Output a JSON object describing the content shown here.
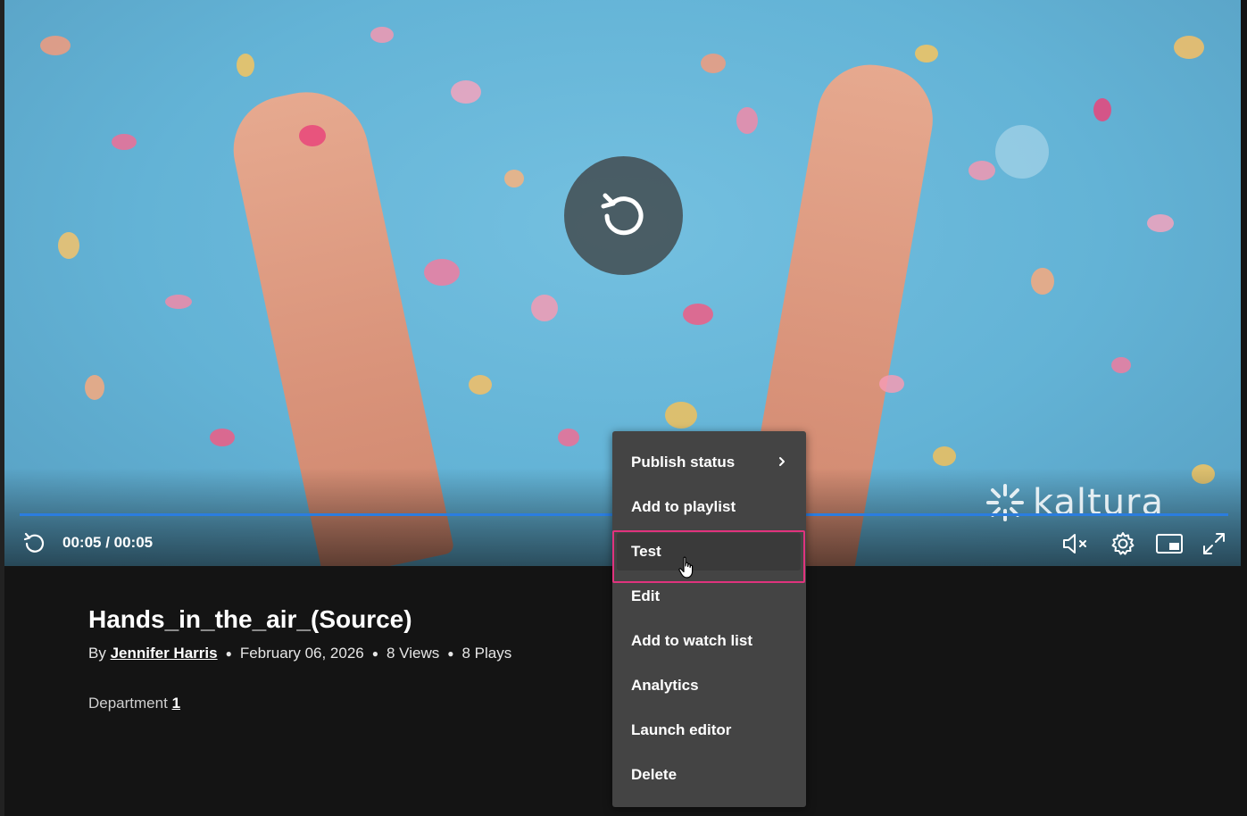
{
  "player": {
    "time_display": "00:05 / 00:05",
    "watermark": "kaltura",
    "progress_fraction": 1.0,
    "accent_color": "#2b7de0",
    "replay_icon": "replay-icon"
  },
  "entry": {
    "title": "Hands_in_the_air_(Source)",
    "by_label": "By",
    "author": "Jennifer Harris",
    "date": "February 06, 2026",
    "views": "8 Views",
    "plays": "8 Plays",
    "department_label": "Department",
    "department_value": "1"
  },
  "menu": {
    "items": [
      {
        "label": "Publish status",
        "has_submenu": true
      },
      {
        "label": "Add to playlist"
      },
      {
        "label": "Test",
        "highlighted": true
      },
      {
        "label": "Edit"
      },
      {
        "label": "Add to watch list"
      },
      {
        "label": "Analytics"
      },
      {
        "label": "Launch editor"
      },
      {
        "label": "Delete"
      }
    ],
    "highlight_color": "#e0337d"
  }
}
